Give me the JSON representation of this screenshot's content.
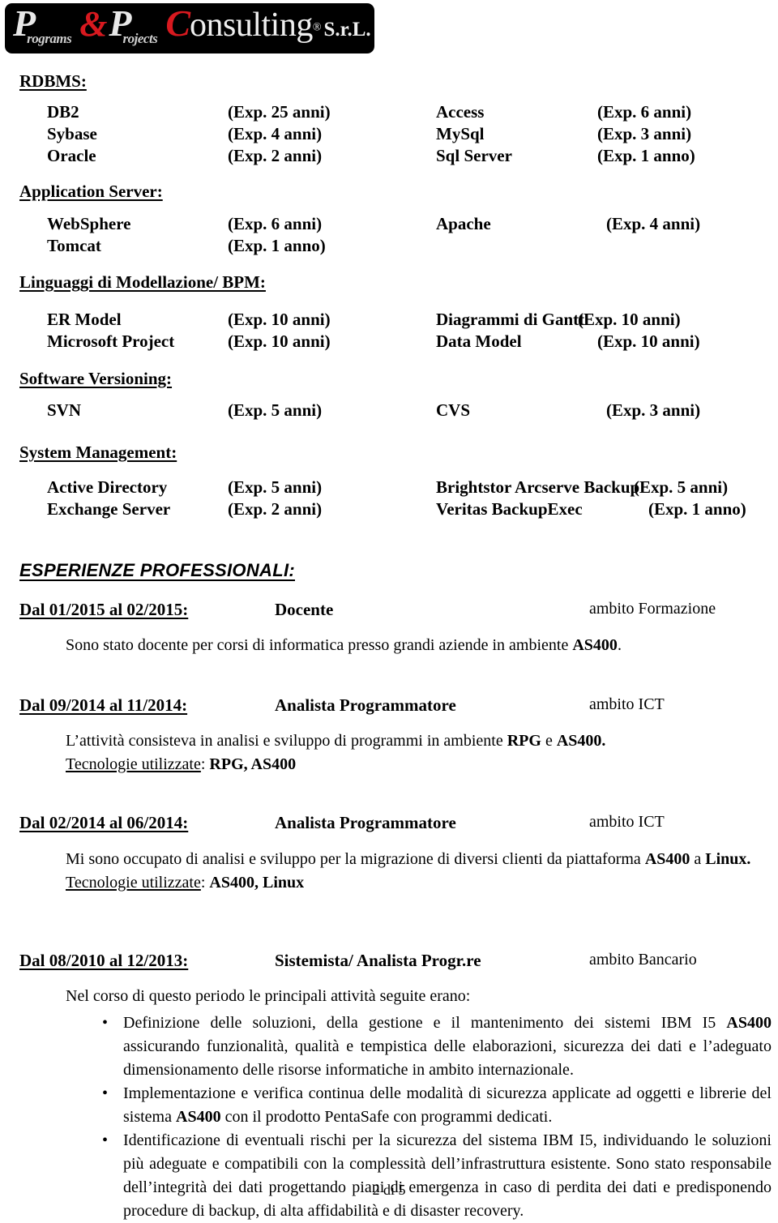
{
  "logo": {
    "p1": "P",
    "p1_sub": "rograms",
    "amp": "&",
    "p2": "P",
    "p2_sub": "rojects",
    "c": "C",
    "word": "onsulting",
    "reg": "®",
    "srl": "S.r.L."
  },
  "sections": [
    {
      "heading": "RDBMS:",
      "rows": [
        {
          "left_name": "DB2",
          "left_exp": "(Exp. 25 anni)",
          "right_name": "Access",
          "right_exp": "(Exp.  6 anni)"
        },
        {
          "left_name": "Sybase",
          "left_exp": "(Exp.  4 anni)",
          "right_name": "MySql",
          "right_exp": "(Exp.  3 anni)"
        },
        {
          "left_name": "Oracle",
          "left_exp": "(Exp.  2 anni)",
          "right_name": "Sql Server",
          "right_exp": "(Exp.  1 anno)"
        }
      ]
    },
    {
      "heading": "Application Server:",
      "rows": [
        {
          "left_name": "WebSphere",
          "left_exp": "(Exp.  6 anni)",
          "right_name": "Apache",
          "right_exp": "(Exp.   4 anni)"
        },
        {
          "left_name": "Tomcat",
          "left_exp": "(Exp.  1 anno)",
          "right_name": "",
          "right_exp": ""
        }
      ]
    },
    {
      "heading": "Linguaggi di Modellazione/ BPM:",
      "rows": [
        {
          "left_name": "ER Model",
          "left_exp": "(Exp. 10 anni)",
          "right_name": "Diagrammi di Gantt",
          "right_exp": "(Exp. 10 anni)"
        },
        {
          "left_name": "Microsoft Project",
          "left_exp": "(Exp. 10 anni)",
          "right_name": "Data Model",
          "right_exp": "(Exp. 10 anni)"
        }
      ]
    },
    {
      "heading": "Software Versioning:",
      "rows": [
        {
          "left_name": "SVN",
          "left_exp": "(Exp.  5 anni)",
          "right_name": "CVS",
          "right_exp": "(Exp.   3 anni)"
        }
      ]
    },
    {
      "heading": "System Management:",
      "rows": [
        {
          "left_name": "Active Directory",
          "left_exp": "(Exp.  5 anni)",
          "right_name": "Brightstor Arcserve Backup",
          "right_exp": "(Exp. 5 anni)"
        },
        {
          "left_name": "Exchange Server",
          "left_exp": "(Exp.  2 anni)",
          "right_name": "Veritas BackupExec",
          "right_exp": "(Exp. 1 anno)"
        }
      ]
    }
  ],
  "experience": {
    "heading": "ESPERIENZE PROFESSIONALI:",
    "entries": [
      {
        "date": "Dal 01/2015 al 02/2015:",
        "role": "Docente",
        "scope": "ambito Formazione",
        "body_html": "Sono stato docente per corsi di informatica presso grandi aziende in ambiente <b>AS400</b>."
      },
      {
        "date": "Dal 09/2014 al 11/2014:",
        "role": "Analista Programmatore",
        "scope": "ambito ICT",
        "body_html": "L&rsquo;attività consisteva in analisi e sviluppo di programmi in ambiente <b>RPG</b> e <b>AS400.</b><br><u>Tecnologie utilizzate</u>: <b>RPG, AS400</b>"
      },
      {
        "date": "Dal 02/2014 al 06/2014:",
        "role": "Analista Programmatore",
        "scope": "ambito ICT",
        "body_html": "Mi sono occupato di analisi e sviluppo per la  migrazione di  diversi clienti da piattaforma <b>AS400</b> a <b>Linux.</b><br><u>Tecnologie utilizzate</u>: <b>AS400, Linux</b>"
      },
      {
        "date": "Dal 08/2010 al 12/2013:",
        "role": "Sistemista/ Analista Progr.re",
        "scope": "ambito Bancario",
        "body_html": "Nel corso di questo periodo le principali attività seguite erano:",
        "bullets": [
          "Definizione delle  soluzioni, della gestione e il mantenimento dei sistemi IBM I5 <b>AS400</b> assicurando funzionalità, qualità e tempistica delle elaborazioni, sicurezza dei dati e l&rsquo;adeguato dimensionamento delle risorse informatiche in ambito internazionale.",
          "Implementazione e verifica continua delle modalità di sicurezza applicate ad oggetti e librerie del sistema <b>AS400</b> con il prodotto PentaSafe con programmi dedicati.",
          "Identificazione di eventuali rischi per la sicurezza del sistema IBM I5, individuando le soluzioni più adeguate e compatibili con la complessità dell&rsquo;infrastruttura esistente. Sono stato responsabile dell&rsquo;integrità dei dati progettando piani di emergenza in caso di perdita dei dati e predisponendo procedure di backup, di alta affidabilità e di disaster recovery."
        ]
      }
    ]
  },
  "footer": {
    "page": "2 di 5"
  }
}
